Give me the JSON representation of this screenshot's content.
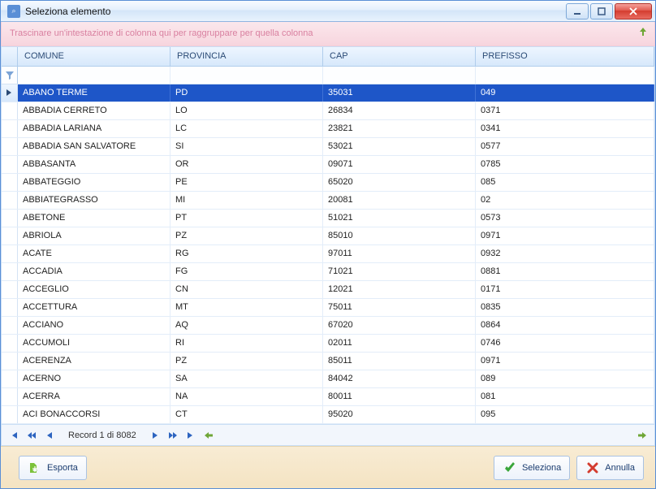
{
  "window": {
    "title": "Seleziona elemento"
  },
  "groupby_hint": "Trascinare un'intestazione di colonna qui per raggruppare per quella colonna",
  "columns": [
    "COMUNE",
    "PROVINCIA",
    "CAP",
    "PREFISSO"
  ],
  "rows": [
    {
      "comune": "ABANO TERME",
      "provincia": "PD",
      "cap": "35031",
      "prefisso": "049",
      "selected": true
    },
    {
      "comune": "ABBADIA CERRETO",
      "provincia": "LO",
      "cap": "26834",
      "prefisso": "0371"
    },
    {
      "comune": "ABBADIA LARIANA",
      "provincia": "LC",
      "cap": "23821",
      "prefisso": "0341"
    },
    {
      "comune": "ABBADIA SAN SALVATORE",
      "provincia": "SI",
      "cap": "53021",
      "prefisso": "0577"
    },
    {
      "comune": "ABBASANTA",
      "provincia": "OR",
      "cap": "09071",
      "prefisso": "0785"
    },
    {
      "comune": "ABBATEGGIO",
      "provincia": "PE",
      "cap": "65020",
      "prefisso": "085"
    },
    {
      "comune": "ABBIATEGRASSO",
      "provincia": "MI",
      "cap": "20081",
      "prefisso": "02"
    },
    {
      "comune": "ABETONE",
      "provincia": "PT",
      "cap": "51021",
      "prefisso": "0573"
    },
    {
      "comune": "ABRIOLA",
      "provincia": "PZ",
      "cap": "85010",
      "prefisso": "0971"
    },
    {
      "comune": "ACATE",
      "provincia": "RG",
      "cap": "97011",
      "prefisso": "0932"
    },
    {
      "comune": "ACCADIA",
      "provincia": "FG",
      "cap": "71021",
      "prefisso": "0881"
    },
    {
      "comune": "ACCEGLIO",
      "provincia": "CN",
      "cap": "12021",
      "prefisso": "0171"
    },
    {
      "comune": "ACCETTURA",
      "provincia": "MT",
      "cap": "75011",
      "prefisso": "0835"
    },
    {
      "comune": "ACCIANO",
      "provincia": "AQ",
      "cap": "67020",
      "prefisso": "0864"
    },
    {
      "comune": "ACCUMOLI",
      "provincia": "RI",
      "cap": "02011",
      "prefisso": "0746"
    },
    {
      "comune": "ACERENZA",
      "provincia": "PZ",
      "cap": "85011",
      "prefisso": "0971"
    },
    {
      "comune": "ACERNO",
      "provincia": "SA",
      "cap": "84042",
      "prefisso": "089"
    },
    {
      "comune": "ACERRA",
      "provincia": "NA",
      "cap": "80011",
      "prefisso": "081"
    },
    {
      "comune": "ACI BONACCORSI",
      "provincia": "CT",
      "cap": "95020",
      "prefisso": "095"
    }
  ],
  "pager": {
    "record_info": "Record 1 di 8082"
  },
  "buttons": {
    "esporta": "Esporta",
    "seleziona": "Seleziona",
    "annulla": "Annulla"
  }
}
